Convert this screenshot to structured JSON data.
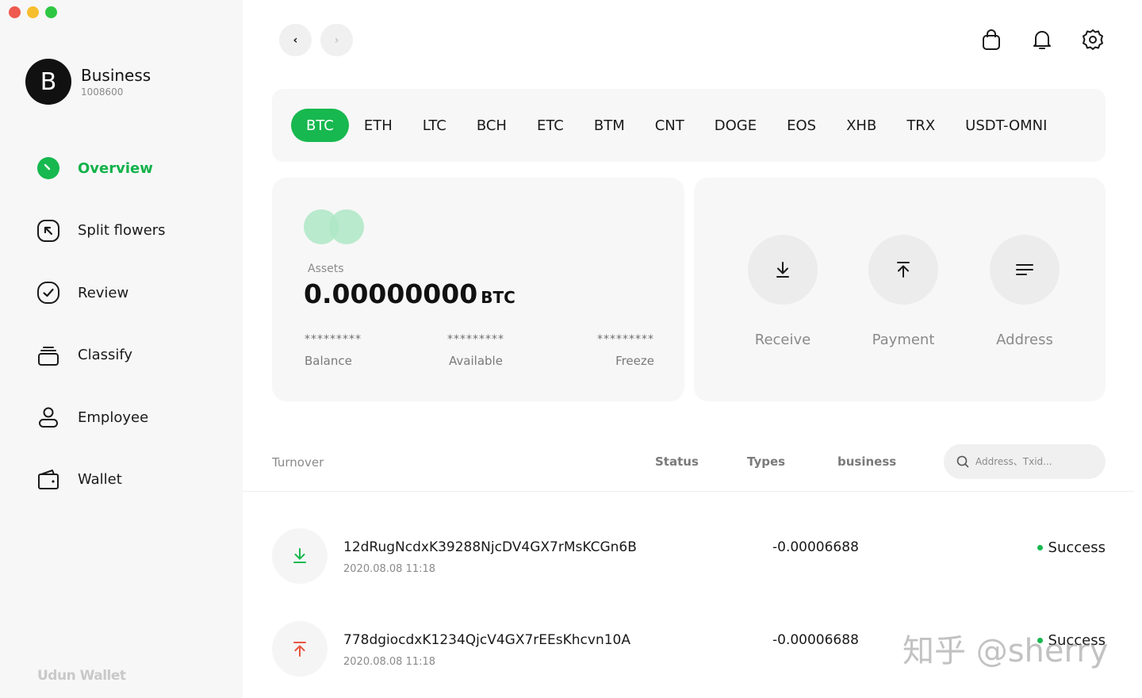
{
  "profile": {
    "initial": "B",
    "name": "Business",
    "id": "1008600"
  },
  "sidebar": {
    "items": [
      {
        "label": "Overview",
        "icon": "overview-icon",
        "active": true
      },
      {
        "label": "Split flowers",
        "icon": "split-arrow-icon",
        "active": false
      },
      {
        "label": "Review",
        "icon": "check-circle-icon",
        "active": false
      },
      {
        "label": "Classify",
        "icon": "stack-icon",
        "active": false
      },
      {
        "label": "Employee",
        "icon": "user-icon",
        "active": false
      },
      {
        "label": "Wallet",
        "icon": "wallet-icon",
        "active": false
      }
    ],
    "brand": "Udun Wallet"
  },
  "topbar": {
    "back": "‹",
    "forward": "›"
  },
  "coins": [
    "BTC",
    "ETH",
    "LTC",
    "BCH",
    "ETC",
    "BTM",
    "CNT",
    "DOGE",
    "EOS",
    "XHB",
    "TRX",
    "USDT-OMNI"
  ],
  "assets": {
    "label": "Assets",
    "value": "0.00000000",
    "unit": "BTC",
    "balance_mask": "*********",
    "balance_label": "Balance",
    "available_mask": "*********",
    "available_label": "Available",
    "freeze_mask": "*********",
    "freeze_label": "Freeze"
  },
  "actions": {
    "receive": "Receive",
    "payment": "Payment",
    "address": "Address"
  },
  "turnover": {
    "label": "Turnover",
    "filters": {
      "status": "Status",
      "types": "Types",
      "business": "business"
    },
    "search_placeholder": "Address、Txid..."
  },
  "transactions": [
    {
      "hash": "12dRugNcdxK39288NjcDV4GX7rMsKCGn6B",
      "time": "2020.08.08  11:18",
      "amount": "-0.00006688",
      "status": "Success",
      "direction": "in"
    },
    {
      "hash": "778dgiocdxK1234QjcV4GX7rEEsKhcvn10A",
      "time": "2020.08.08  11:18",
      "amount": "-0.00006688",
      "status": "Success",
      "direction": "out"
    }
  ],
  "watermark": "知乎 @sherry",
  "colors": {
    "accent": "#17b84f",
    "receive": "#17b84f",
    "send": "#e8563f"
  }
}
